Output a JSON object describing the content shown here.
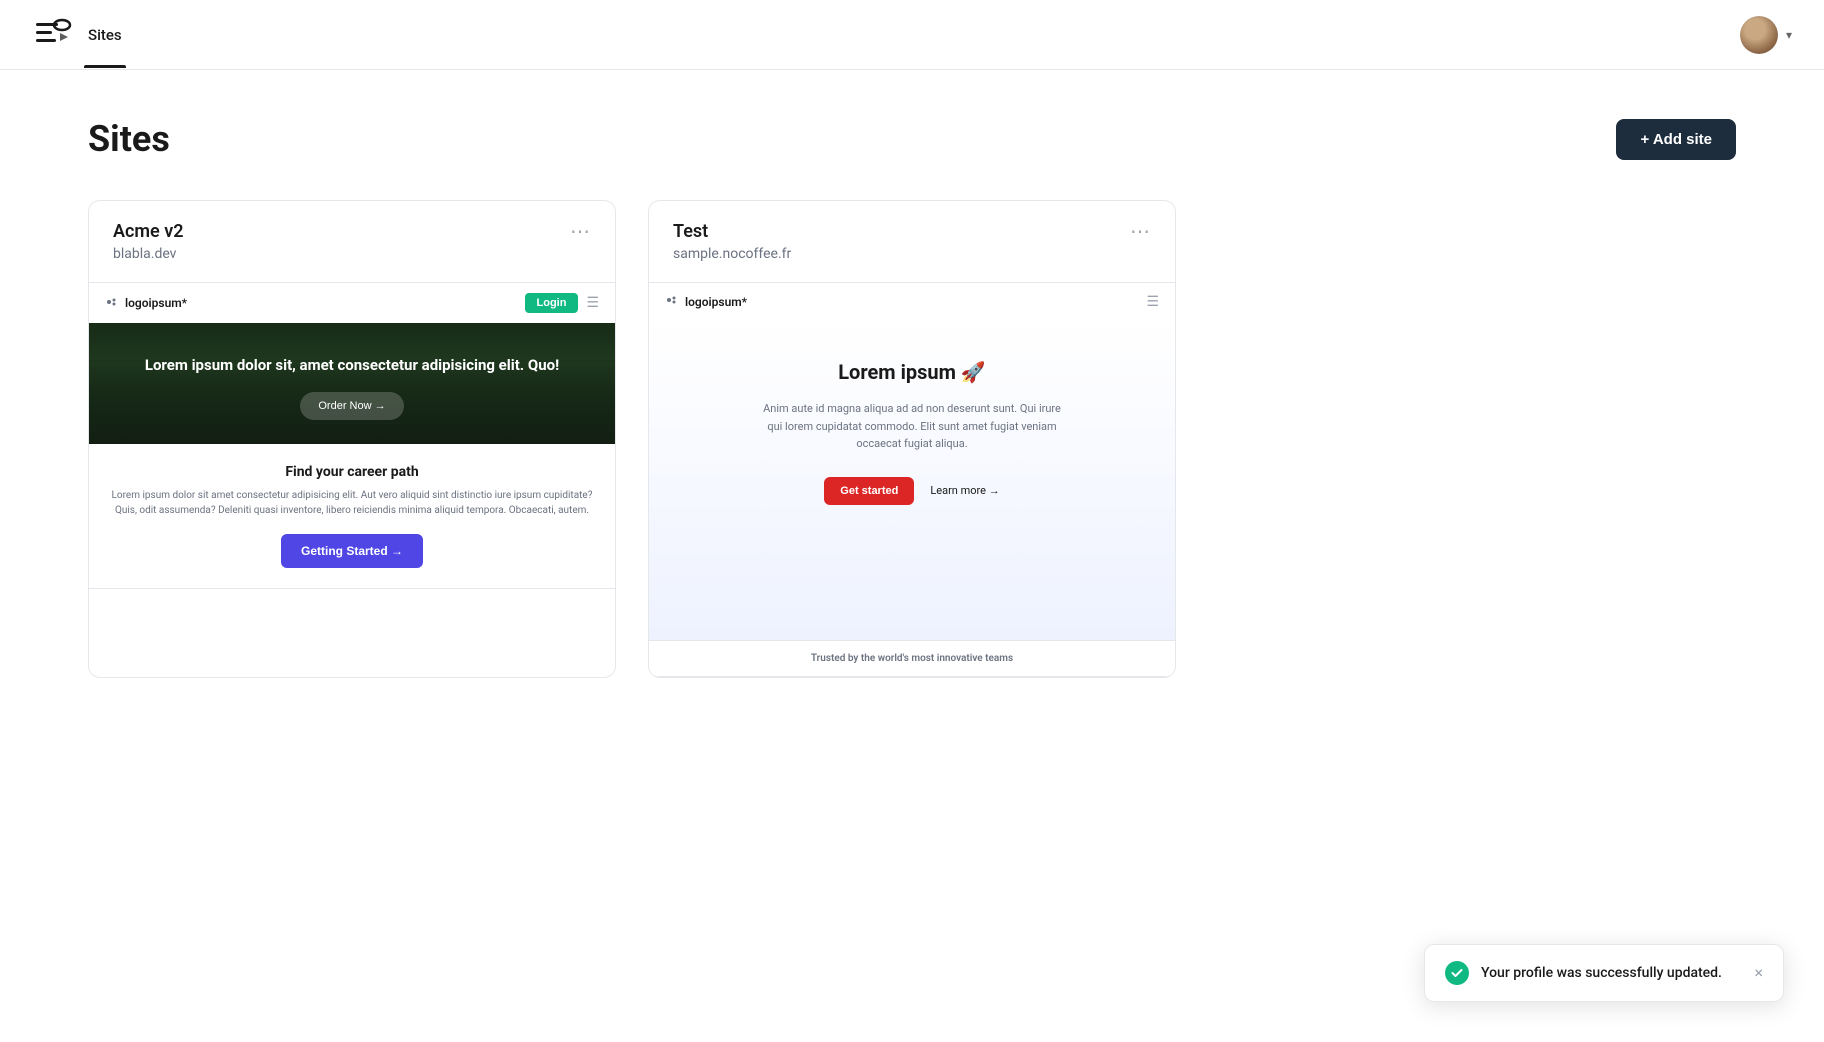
{
  "header": {
    "logo_alt": "App logo",
    "nav_items": [
      {
        "label": "Sites",
        "active": true
      }
    ],
    "user_chevron": "▾"
  },
  "page": {
    "title": "Sites",
    "add_site_label": "+ Add site"
  },
  "cards": [
    {
      "id": "acme-v2",
      "title": "Acme v2",
      "domain": "blabla.dev",
      "preview": {
        "nav_logo": "logoipsum*",
        "nav_login": "Login",
        "hero_title": "Lorem ipsum dolor sit, amet consectetur adipisicing elit. Quo!",
        "hero_btn": "Order Now →",
        "body_title": "Find your career path",
        "body_text": "Lorem ipsum dolor sit amet consectetur adipisicing elit. Aut vero aliquid sint distinctio iure ipsum cupiditate? Quis, odit assumenda? Deleniti quasi inventore, libero reiciendis minima aliquid tempora. Obcaecati, autem.",
        "cta_btn": "Getting Started →"
      }
    },
    {
      "id": "test",
      "title": "Test",
      "domain": "sample.nocoffee.fr",
      "preview": {
        "nav_logo": "logoipsum*",
        "hero_title": "Lorem ipsum 🚀",
        "hero_text": "Anim aute id magna aliqua ad ad non deserunt sunt. Qui irure qui lorem cupidatat commodo. Elit sunt amet fugiat veniam occaecat fugiat aliqua.",
        "get_started": "Get started",
        "learn_more": "Learn more →",
        "trusted": "Trusted by the world's most innovative teams"
      }
    }
  ],
  "toast": {
    "message": "Your profile was successfully updated.",
    "close": "×"
  }
}
